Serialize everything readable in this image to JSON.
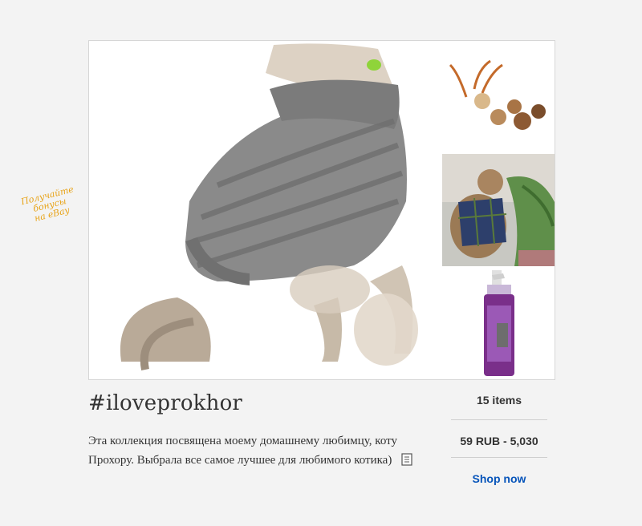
{
  "promo_text": "Получайте\nбонусы\nна eBay",
  "collection": {
    "title": "#iloveprokhor",
    "description": "Эта коллекция посвящена моему домашнему любимцу, коту Прохору. Выбрала все самое лучшее для любимого котика)",
    "note_icon": "document-icon"
  },
  "sidebar": {
    "items_count": "15 items",
    "price_range": "59 RUB - 5,030",
    "shop_label": "Shop now"
  },
  "images": {
    "main": "cat-in-grey-sweater",
    "thumb1": "cat-toy-balls",
    "thumb2": "cat-in-plaid-harness",
    "thumb3": "cat-shampoo-bottle"
  },
  "colors": {
    "promo": "#e8a317",
    "link": "#0654ba",
    "text": "#333333"
  }
}
